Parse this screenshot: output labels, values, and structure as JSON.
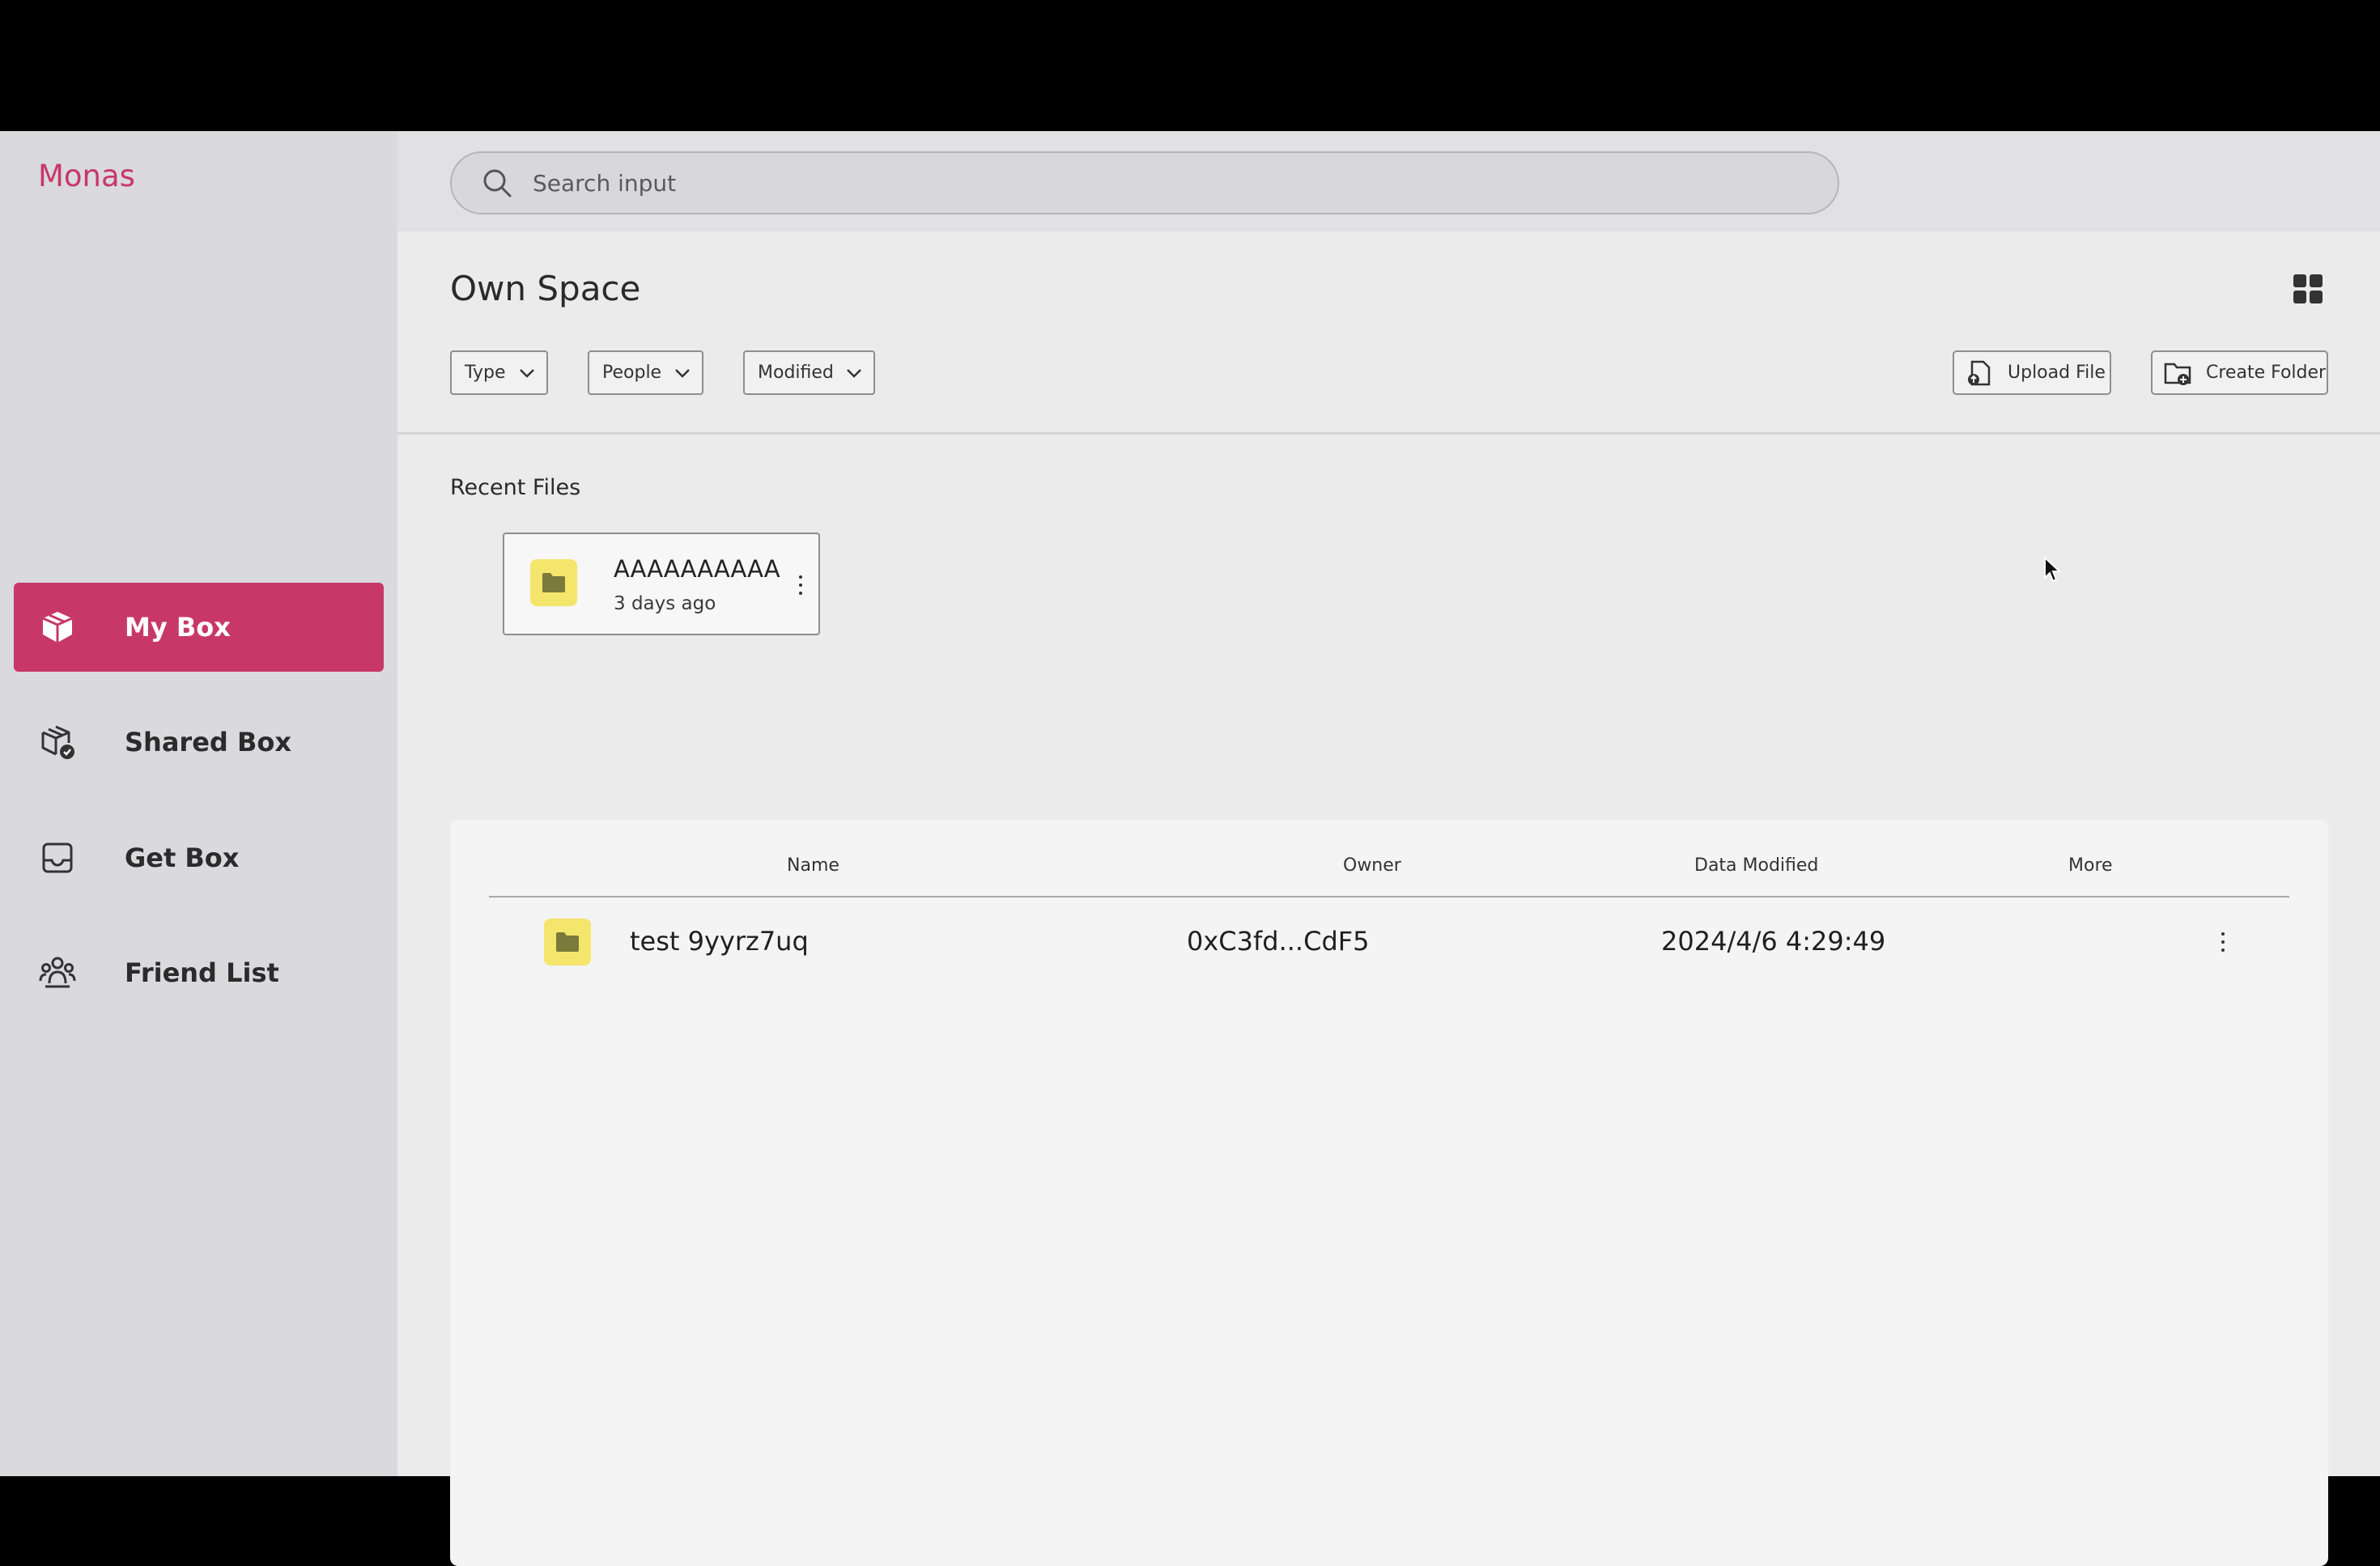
{
  "app": {
    "logo": "Monas"
  },
  "sidebar": {
    "items": [
      {
        "label": "My Box",
        "icon": "box-icon",
        "active": true
      },
      {
        "label": "Shared Box",
        "icon": "shared-box-icon",
        "active": false
      },
      {
        "label": "Get Box",
        "icon": "inbox-icon",
        "active": false
      },
      {
        "label": "Friend List",
        "icon": "friends-icon",
        "active": false
      }
    ]
  },
  "search": {
    "placeholder": "Search input",
    "value": ""
  },
  "header": {
    "title": "Own Space",
    "view_toggle_icon": "grid-view-icon"
  },
  "filters": [
    {
      "label": "Type"
    },
    {
      "label": "People"
    },
    {
      "label": "Modified"
    }
  ],
  "actions": {
    "upload_label": "Upload File",
    "create_folder_label": "Create Folder"
  },
  "recent": {
    "title": "Recent Files",
    "items": [
      {
        "name": "AAAAAAAAAA",
        "time": "3 days ago"
      }
    ]
  },
  "table": {
    "columns": [
      "Name",
      "Owner",
      "Data Modified",
      "More"
    ],
    "rows": [
      {
        "name": "test 9yyrz7uq",
        "owner": "0xC3fd...CdF5",
        "modified": "2024/4/6 4:29:49"
      }
    ]
  },
  "colors": {
    "accent": "#c73868",
    "folder": "#f4e56c",
    "sidebar_bg": "#dad9dc",
    "main_bg": "#ebebeb"
  }
}
